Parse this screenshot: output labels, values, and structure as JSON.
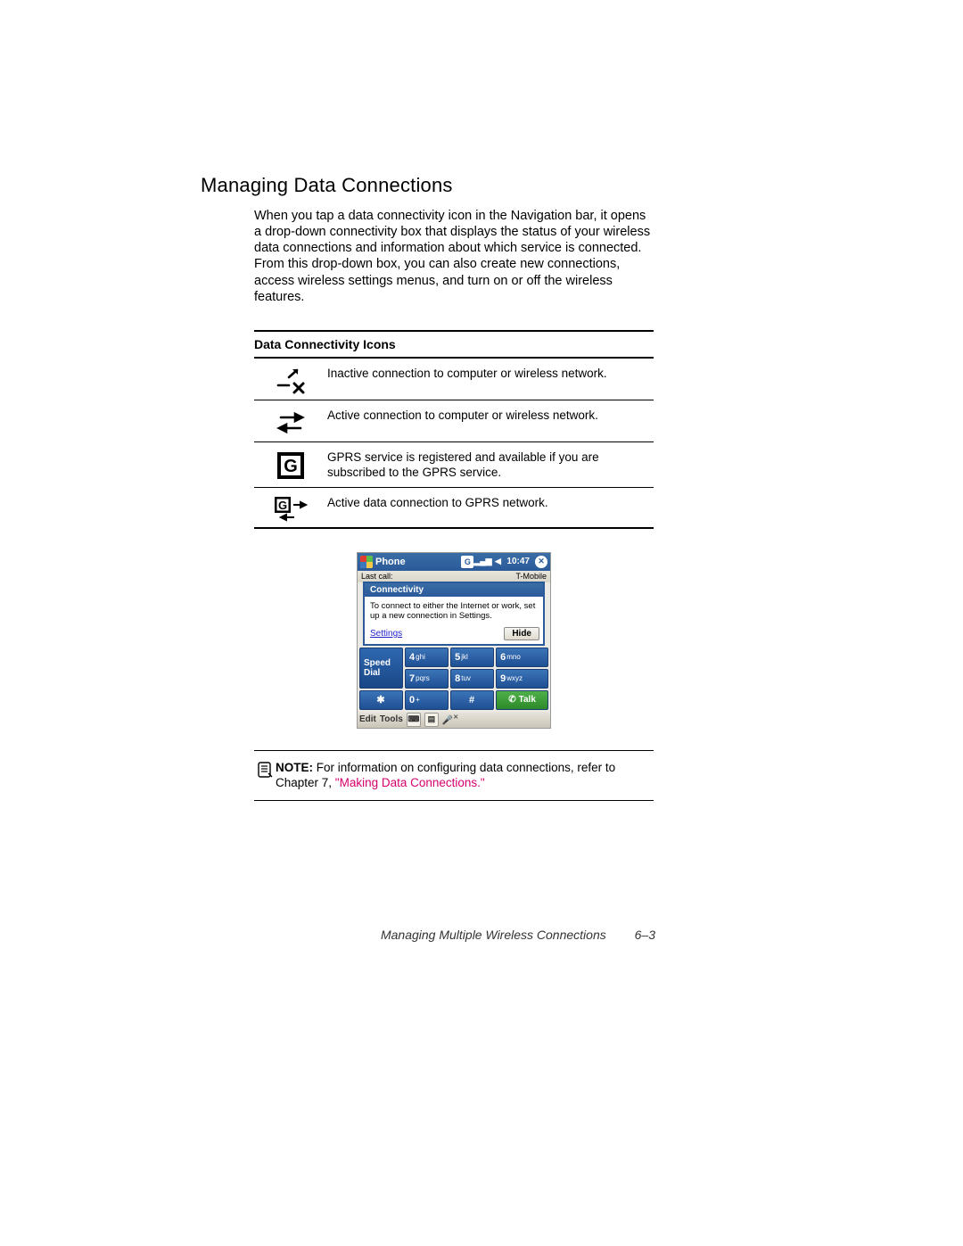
{
  "section_title": "Managing Data Connections",
  "intro": "When you tap a data connectivity icon in the Navigation bar, it opens a drop-down connectivity box that displays the status of your wireless data connections and information about which service is connected. From this drop-down box, you can also create new connections, access wireless settings menus, and turn on or off the wireless features.",
  "table_header": "Data Connectivity Icons",
  "icons": [
    {
      "name": "inactive-connection-icon",
      "desc": "Inactive connection to computer or wireless network."
    },
    {
      "name": "active-connection-icon",
      "desc": "Active connection to computer or wireless network."
    },
    {
      "name": "gprs-available-icon",
      "desc": "GPRS service is registered and available if you are subscribed to the GPRS service."
    },
    {
      "name": "gprs-active-icon",
      "desc": "Active data connection to GPRS network."
    }
  ],
  "screenshot": {
    "titlebar": {
      "app": "Phone",
      "time": "10:47"
    },
    "carrier": "T-Mobile",
    "last_label": "Last call:",
    "popup": {
      "title": "Connectivity",
      "body": "To connect to either the Internet or work, set up a new connection in Settings.",
      "settings_link": "Settings",
      "hide": "Hide"
    },
    "keys": {
      "r1": [
        {
          "n": "4",
          "s": "ghi"
        },
        {
          "n": "5",
          "s": "jkl"
        },
        {
          "n": "6",
          "s": "mno"
        }
      ],
      "r2": [
        {
          "n": "7",
          "s": "pqrs"
        },
        {
          "n": "8",
          "s": "tuv"
        },
        {
          "n": "9",
          "s": "wxyz"
        }
      ],
      "r3": [
        {
          "n": "✱",
          "s": ""
        },
        {
          "n": "0",
          "s": "+"
        },
        {
          "n": "#",
          "s": ""
        }
      ],
      "speed": "Speed Dial",
      "talk": "Talk"
    },
    "bottombar": {
      "edit": "Edit",
      "tools": "Tools"
    }
  },
  "note": {
    "label": "NOTE:",
    "text_before": "  For information on configuring data connections, refer to Chapter 7, ",
    "link": "\"Making Data Connections.\""
  },
  "footer": {
    "title": "Managing Multiple Wireless Connections",
    "page": "6–3"
  }
}
